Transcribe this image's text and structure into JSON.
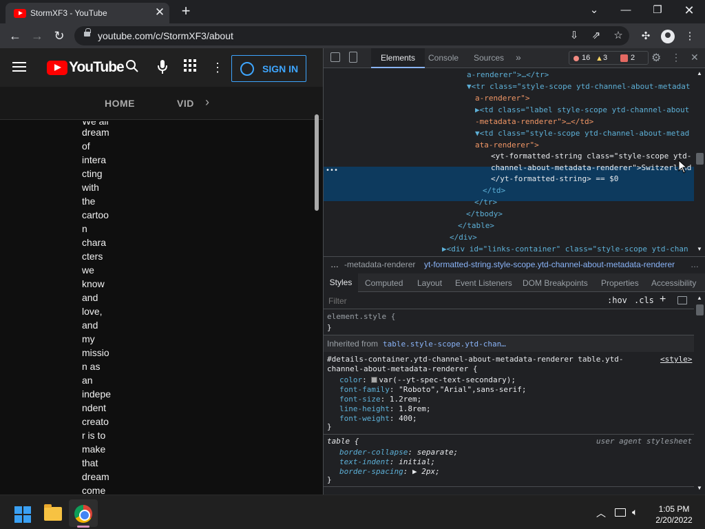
{
  "browser": {
    "tab_title": "StormXF3 - YouTube",
    "url": "youtube.com/c/StormXF3/about",
    "new_tab": "+",
    "tab_close": "✕"
  },
  "youtube": {
    "logo_text": "YouTube",
    "sign_in": "SIGN IN",
    "tabs": [
      "HOME",
      "VID"
    ],
    "description_lines": [
      "We all",
      "dream",
      "of",
      "intera",
      "cting",
      "with",
      "the",
      "cartoo",
      "n",
      "chara",
      "cters",
      "we",
      "know",
      "and",
      "love,",
      "and",
      "my",
      "missio",
      "n as",
      "an",
      "indepe",
      "ndent",
      "creato",
      "r is to",
      "make",
      "that",
      "dream",
      "come"
    ]
  },
  "devtools": {
    "tabs": [
      "Elements",
      "Console",
      "Sources",
      "»"
    ],
    "errors": "16",
    "warnings": "3",
    "issues": "2",
    "dom_lines": [
      {
        "a": "a-renderer\">…</tr>"
      },
      {
        "a": "▼<tr class=\"style-scope ytd-channel-about-metadat"
      },
      {
        "a": "a-renderer\">"
      },
      {
        "a": "▶<td class=\"label style-scope ytd-channel-about"
      },
      {
        "a": "-metadata-renderer\">…</td>"
      },
      {
        "a": "▼<td class=\"style-scope ytd-channel-about-metad"
      },
      {
        "a": "ata-renderer\">"
      },
      {
        "a": "<yt-formatted-string class=\"style-scope ytd-"
      },
      {
        "a": "channel-about-metadata-renderer\">Switzerland"
      },
      {
        "a": "</yt-formatted-string> == $0"
      },
      {
        "a": "</td>"
      },
      {
        "a": "</tr>"
      },
      {
        "a": "</tbody>"
      },
      {
        "a": "</table>"
      },
      {
        "a": "</div>"
      },
      {
        "a": "▶<div id=\"links-container\" class=\"style-scope ytd-chan"
      }
    ],
    "breadcrumb_prefix": "…",
    "breadcrumb_1": "-metadata-renderer",
    "breadcrumb_2": "yt-formatted-string.style-scope.ytd-channel-about-metadata-renderer",
    "breadcrumb_more": "…",
    "style_tabs": [
      "Styles",
      "Computed",
      "Layout",
      "Event Listeners",
      "DOM Breakpoints",
      "Properties",
      "Accessibility"
    ],
    "filter_placeholder": "Filter",
    "hov": ":hov",
    "cls": ".cls",
    "element_style": "element.style {",
    "close_brace": "}",
    "inherited_label": "Inherited from",
    "inherited_from": "table.style-scope.ytd-chan…",
    "rule1_selector_1": "#details-container.ytd-channel-about-metadata-renderer table.ytd-",
    "rule1_selector_2": "channel-about-metadata-renderer {",
    "rule1_source": "<style>",
    "rule1_props": [
      {
        "name": "color",
        "value": "var(--yt-spec-text-secondary);"
      },
      {
        "name": "font-family",
        "value": "\"Roboto\",\"Arial\",sans-serif;"
      },
      {
        "name": "font-size",
        "value": "1.2rem;"
      },
      {
        "name": "line-height",
        "value": "1.8rem;"
      },
      {
        "name": "font-weight",
        "value": "400;"
      }
    ],
    "rule2_selector": "table {",
    "rule2_source": "user agent stylesheet",
    "rule2_props": [
      {
        "name": "border-collapse",
        "value": "separate;"
      },
      {
        "name": "text-indent",
        "value": "initial;"
      },
      {
        "name": "border-spacing",
        "value": "▶ 2px;"
      }
    ]
  },
  "taskbar": {
    "time": "1:05 PM",
    "date": "2/20/2022"
  },
  "colors": {
    "accent_blue": "#3ea6ff",
    "youtube_red": "#ff0000",
    "selection": "#0d3a5e"
  }
}
